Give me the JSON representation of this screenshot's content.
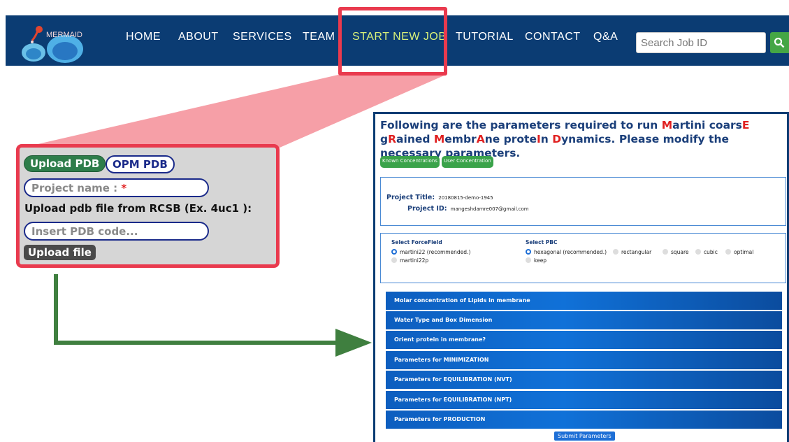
{
  "navbar": {
    "logo_text": "MERMAID",
    "items": [
      "HOME",
      "ABOUT",
      "SERVICES",
      "TEAM",
      "START NEW JOB",
      "TUTORIAL",
      "CONTACT",
      "Q&A"
    ],
    "search_placeholder": "Search Job ID",
    "search_icon": "search-icon"
  },
  "upload_panel": {
    "upload_pdb_label": "Upload PDB",
    "opm_pdb_label": "OPM PDB",
    "project_name_placeholder": "Project name : ",
    "required_mark": "*",
    "rcsb_label": "Upload pdb file from RCSB (Ex. 4uc1 ):",
    "pdb_code_placeholder": "Insert PDB code...",
    "upload_file_label": "Upload file"
  },
  "params": {
    "heading_parts": [
      {
        "t": "Following are the parameters required to run ",
        "h": false
      },
      {
        "t": "M",
        "h": true
      },
      {
        "t": "artini coars",
        "h": false
      },
      {
        "t": "E",
        "h": true
      },
      {
        "t": " g",
        "h": false
      },
      {
        "t": "R",
        "h": true
      },
      {
        "t": "ained ",
        "h": false
      },
      {
        "t": "M",
        "h": true
      },
      {
        "t": "embr",
        "h": false
      },
      {
        "t": "A",
        "h": true
      },
      {
        "t": "ne prote",
        "h": false
      },
      {
        "t": "I",
        "h": true
      },
      {
        "t": "n ",
        "h": false
      },
      {
        "t": "D",
        "h": true
      },
      {
        "t": "ynamics. Please modify the necessary parameters.",
        "h": false
      }
    ],
    "known_concentrations_label": "Known Concentrations",
    "user_concentration_label": "User Concentration",
    "project_title_label": "Project Title:",
    "project_title_value": "20180815-demo-1945",
    "project_id_label": "Project ID:",
    "project_id_value": "mangeshdamre007@gmail.com",
    "forcefield_title": "Select ForceField",
    "forcefield_options": [
      "martini22 (recommended.)",
      "martini22p"
    ],
    "pbc_title": "Select PBC",
    "pbc_options": [
      "hexagonal (recommended.)",
      "rectangular",
      "square",
      "cubic",
      "optimal",
      "keep"
    ],
    "sections": [
      "Molar concentration of Lipids in membrane",
      "Water Type and Box Dimension",
      "Orient protein in membrane?",
      "Parameters for MINIMIZATION",
      "Parameters for EQUILIBRATION (NVT)",
      "Parameters for EQUILIBRATION (NPT)",
      "Parameters for PRODUCTION"
    ],
    "submit_label": "Submit Parameters"
  },
  "colors": {
    "navbar_bg": "#0b3c73",
    "active_nav": "#d9f27a",
    "highlight_red": "#e93a4e",
    "arrow_green": "#3f7f3f"
  }
}
